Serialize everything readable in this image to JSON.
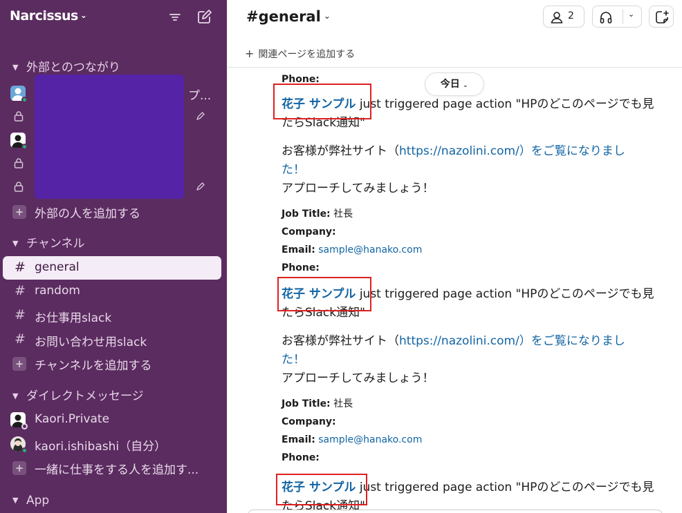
{
  "workspace": {
    "name": "Narcissus",
    "chevron": "⌄"
  },
  "sidebar": {
    "sections": [
      {
        "title": "外部とのつながり"
      },
      {
        "title": "チャンネル"
      },
      {
        "title": "ダイレクトメッセージ"
      },
      {
        "title": "App"
      }
    ],
    "external": {
      "partial_label": "プ...",
      "add_label": "外部の人を追加する"
    },
    "channels": [
      {
        "name": "general",
        "active": true
      },
      {
        "name": "random"
      },
      {
        "name": "お仕事用slack"
      },
      {
        "name": "お問い合わせ用slack"
      }
    ],
    "add_channel_label": "チャンネルを追加する",
    "dms": [
      {
        "name": "Kaori.Private"
      },
      {
        "name": "kaori.ishibashi（自分）"
      }
    ],
    "add_dm_label": "一緒に仕事をする人を追加す..."
  },
  "channel": {
    "hash": "#",
    "name": "general",
    "member_count": "2",
    "add_bookmark_label": "関連ページを追加する",
    "date_label": "今日"
  },
  "messages": {
    "phone_label": "Phone:",
    "sender": "花子 サンプル",
    "action_text": " just triggered page action \"HPのどこのページでも見",
    "action_text_2": "たらSlack通知\"",
    "visit_prefix": "お客様が弊社サイト（",
    "visit_url": "https://nazolini.com/",
    "visit_suffix": "）をご覧になりまし",
    "visit_line2": "た！",
    "approach": "アプローチしてみましょう！",
    "job_title_label": "Job Title:",
    "job_title_value": " 社長",
    "company_label": "Company:",
    "email_label": "Email:",
    "email_value": "sample@hanako.com"
  },
  "colors": {
    "sidebar_bg": "#5b2c60",
    "redaction": "#5523a6",
    "link": "#1264a3",
    "highlight_box": "#e01e1e",
    "presence_online": "#2bac76"
  }
}
